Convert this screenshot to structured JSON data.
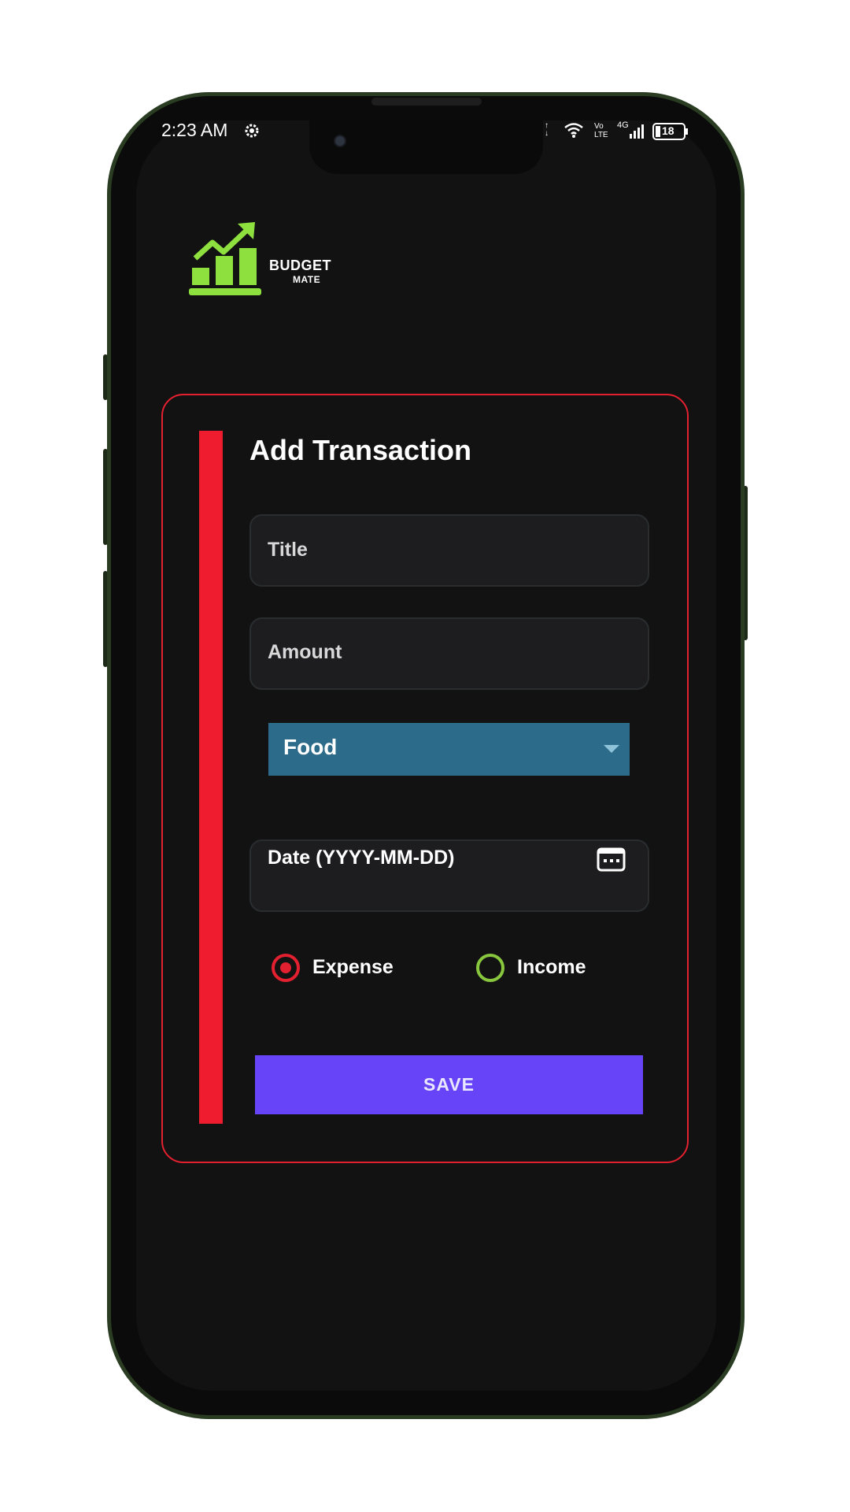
{
  "status_bar": {
    "time": "2:23 AM",
    "network_label": "Vo LTE",
    "signal_label": "4G",
    "battery": "18"
  },
  "logo": {
    "line1": "BUDGET",
    "line2": "MATE",
    "accent_color": "#8ee03f"
  },
  "form": {
    "title": "Add Transaction",
    "title_placeholder": "Title",
    "amount_placeholder": "Amount",
    "category": {
      "selected": "Food"
    },
    "date_placeholder": "Date (YYYY-MM-DD)",
    "type_options": [
      {
        "label": "Expense",
        "selected": true,
        "color": "#e3202f"
      },
      {
        "label": "Income",
        "selected": false,
        "color": "#88c73d"
      }
    ],
    "save_label": "SAVE"
  },
  "colors": {
    "card_border": "#e3202f",
    "accent_bar": "#ee1c2e",
    "dropdown_bg": "#2c6b8a",
    "save_button": "#6744f8",
    "background": "#121212"
  }
}
